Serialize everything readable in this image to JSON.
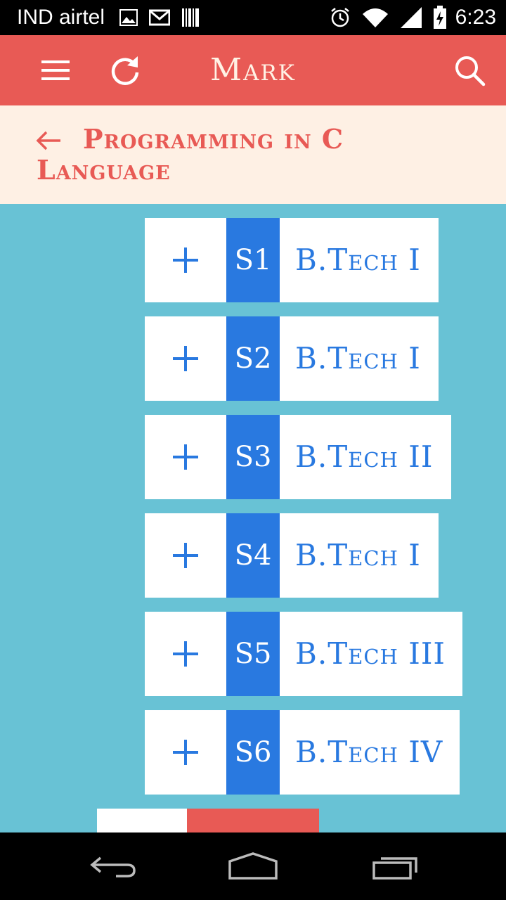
{
  "status_bar": {
    "carrier": "IND airtel",
    "time": "6:23",
    "icons_left": [
      "gallery-icon",
      "gmail-icon",
      "barcode-icon"
    ],
    "icons_right": [
      "alarm-icon",
      "wifi-icon",
      "signal-icon",
      "battery-icon"
    ]
  },
  "app_bar": {
    "title": "Mark",
    "left_icons": [
      "menu-icon",
      "refresh-icon"
    ],
    "right_icon": "search-icon",
    "color": "#E85A55"
  },
  "sub_header": {
    "title": "Programming in C Language",
    "back_icon": "back-arrow-icon"
  },
  "sections": [
    {
      "code": "S1",
      "label": "B.Tech I"
    },
    {
      "code": "S2",
      "label": "B.Tech I"
    },
    {
      "code": "S3",
      "label": "B.Tech II"
    },
    {
      "code": "S4",
      "label": "B.Tech I"
    },
    {
      "code": "S5",
      "label": "B.Tech III"
    },
    {
      "code": "S6",
      "label": "B.Tech IV"
    }
  ],
  "colors": {
    "background": "#68C2D5",
    "accent_blue": "#2979E0",
    "accent_red": "#E85A55",
    "subheader_bg": "#FEF0E4"
  },
  "nav_bar": {
    "icons": [
      "back-icon",
      "home-icon",
      "recents-icon"
    ]
  }
}
